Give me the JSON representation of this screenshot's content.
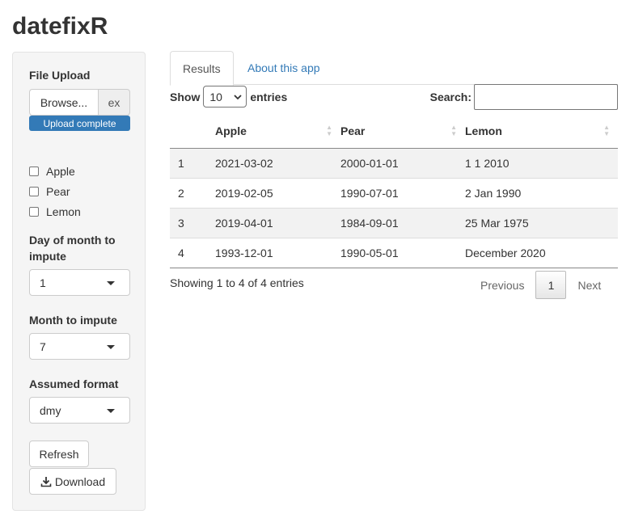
{
  "app": {
    "title": "datefixR"
  },
  "sidebar": {
    "file_upload_label": "File Upload",
    "browse_label": "Browse...",
    "file_name": "ex",
    "upload_status": "Upload complete",
    "checkboxes": [
      {
        "label": "Apple",
        "checked": false
      },
      {
        "label": "Pear",
        "checked": false
      },
      {
        "label": "Lemon",
        "checked": false
      }
    ],
    "day_label": "Day of month to impute",
    "day_value": "1",
    "month_label": "Month to impute",
    "month_value": "7",
    "format_label": "Assumed format",
    "format_value": "dmy",
    "refresh_label": "Refresh",
    "download_label": "Download"
  },
  "tabs": [
    {
      "label": "Results",
      "active": true
    },
    {
      "label": "About this app",
      "active": false
    }
  ],
  "table_controls": {
    "show_label": "Show",
    "length_value": "10",
    "entries_label": "entries",
    "search_label": "Search:"
  },
  "table": {
    "columns": [
      "",
      "Apple",
      "Pear",
      "Lemon"
    ],
    "rows": [
      [
        "1",
        "2021-03-02",
        "2000-01-01",
        "1 1 2010"
      ],
      [
        "2",
        "2019-02-05",
        "1990-07-01",
        "2 Jan 1990"
      ],
      [
        "3",
        "2019-04-01",
        "1984-09-01",
        "25 Mar 1975"
      ],
      [
        "4",
        "1993-12-01",
        "1990-05-01",
        "December 2020"
      ]
    ]
  },
  "footer": {
    "info": "Showing 1 to 4 of 4 entries",
    "previous_label": "Previous",
    "current_page": "1",
    "next_label": "Next"
  }
}
